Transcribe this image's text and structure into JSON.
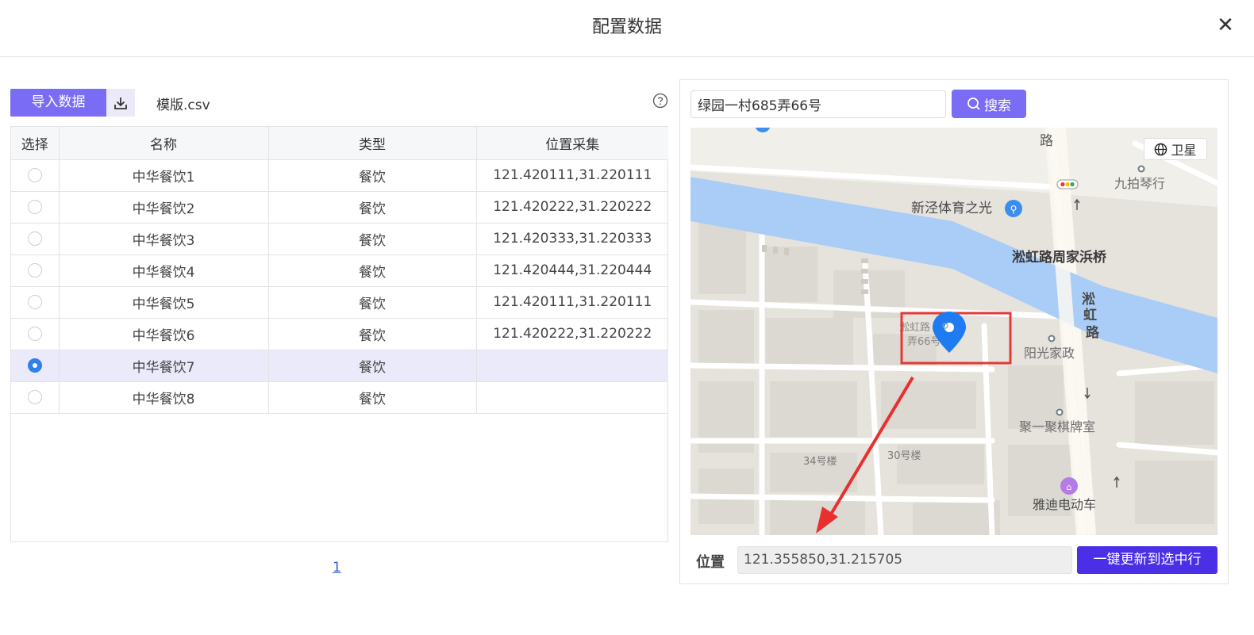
{
  "dialog": {
    "title": "配置数据",
    "close_icon": "close-icon"
  },
  "toolbar": {
    "import_label": "导入数据",
    "download_icon": "download-icon",
    "template_file": "模版.csv",
    "help_icon": "question-circle-icon"
  },
  "table": {
    "columns": [
      "选择",
      "名称",
      "类型",
      "位置采集"
    ],
    "rows": [
      {
        "name": "中华餐饮1",
        "type": "餐饮",
        "location": "121.420111,31.220111",
        "selected": false
      },
      {
        "name": "中华餐饮2",
        "type": "餐饮",
        "location": "121.420222,31.220222",
        "selected": false
      },
      {
        "name": "中华餐饮3",
        "type": "餐饮",
        "location": "121.420333,31.220333",
        "selected": false
      },
      {
        "name": "中华餐饮4",
        "type": "餐饮",
        "location": "121.420444,31.220444",
        "selected": false
      },
      {
        "name": "中华餐饮5",
        "type": "餐饮",
        "location": "121.420111,31.220111",
        "selected": false
      },
      {
        "name": "中华餐饮6",
        "type": "餐饮",
        "location": "121.420222,31.220222",
        "selected": false
      },
      {
        "name": "中华餐饮7",
        "type": "餐饮",
        "location": "",
        "selected": true
      },
      {
        "name": "中华餐饮8",
        "type": "餐饮",
        "location": "",
        "selected": false
      }
    ]
  },
  "pagination": {
    "current_page": "1"
  },
  "map_panel": {
    "search_value": "绿园一村685弄66号",
    "search_label": "搜索",
    "satellite_label": "卫星",
    "location_label": "位置",
    "location_value": "121.355850,31.215705",
    "update_label": "一键更新到选中行",
    "labels": {
      "road_top": "路",
      "piano": "九拍琴行",
      "sports": "新泾体育之光",
      "bridge": "淞虹路周家浜桥",
      "song": "淞",
      "hong": "虹",
      "lu": "路",
      "pin_line1": "淞虹路",
      "pin_line2": "弄66号",
      "housekeeping": "阳光家政",
      "chess": "聚一聚棋牌室",
      "bldg34": "34号楼",
      "bldg30": "30号楼",
      "ebike": "雅迪电动车"
    },
    "colors": {
      "accent": "#7b6cf6",
      "update_button": "#4b2fe6",
      "river": "#a9cdf7",
      "pin": "#1f7bf2",
      "highlight_box": "#e53935",
      "arrow": "#e8302e"
    }
  }
}
